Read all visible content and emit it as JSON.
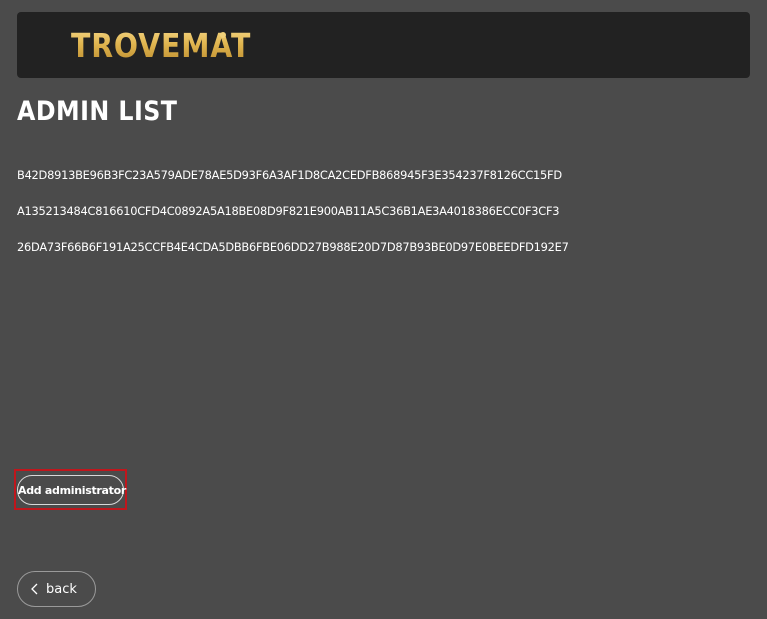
{
  "header": {
    "logo_text": "TROVEMAT"
  },
  "page": {
    "title": "ADMIN LIST"
  },
  "admins": [
    "B42D8913BE96B3FC23A579ADE78AE5D93F6A3AF1D8CA2CEDFB868945F3E354237F8126CC15FD",
    "A135213484C816610CFD4C0892A5A18BE08D9F821E900AB11A5C36B1AE3A4018386ECC0F3CF3",
    "26DA73F66B6F191A25CCFB4E4CDA5DBB6FBE06DD27B988E20D7D87B93BE0D97E0BEEDFD192E7"
  ],
  "actions": {
    "add_admin_label": "Add administrator",
    "back_label": "back",
    "back_icon": "chevron-left-icon"
  },
  "colors": {
    "background": "#4b4b4b",
    "header_bg": "#222222",
    "logo_gold": "#e0b54f",
    "highlight": "#c0161c"
  }
}
